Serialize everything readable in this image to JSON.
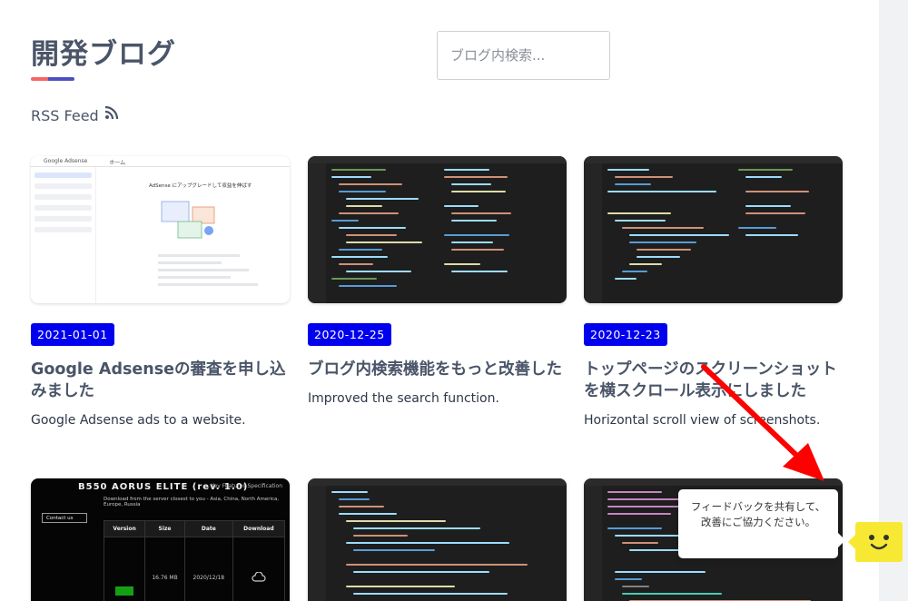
{
  "header": {
    "title": "開発ブログ",
    "search_placeholder": "ブログ内検索...",
    "rss_label": "RSS Feed"
  },
  "thumb_text": {
    "adsense_app": "Google Adsense",
    "adsense_home": "ホーム",
    "adsense_heading": "AdSense にアップグレードして収益を伸ばす",
    "spec_title": "B550 AORUS ELITE (rev. 1.0)",
    "spec_nav": "Key Features   Specification",
    "spec_download": "Download from the server closest to you - Asia, China, North America, Europe, Russia",
    "spec_button": "Contact us",
    "spec_version": "Version",
    "spec_size": "Size",
    "spec_date": "Date",
    "spec_dl": "Download",
    "spec_size_val": "16.76 MB",
    "spec_date_val": "2020/12/18"
  },
  "posts": [
    {
      "date": "2021-01-01",
      "title": "Google Adsenseの審査を申し込みました",
      "desc": "Google Adsense ads to a website."
    },
    {
      "date": "2020-12-25",
      "title": "ブログ内検索機能をもっと改善した",
      "desc": "Improved the search function."
    },
    {
      "date": "2020-12-23",
      "title": "トップページのスクリーンショットを横スクロール表示にしました",
      "desc": "Horizontal scroll view of screenshots."
    }
  ],
  "feedback": {
    "message": "フィードバックを共有して、改善にご協力ください。"
  },
  "colors": {
    "badge": "#0000ee",
    "accent_red": "#f56565",
    "accent_indigo": "#4c51bf",
    "feedback_yellow": "#f7e933",
    "arrow": "#ff0000"
  }
}
